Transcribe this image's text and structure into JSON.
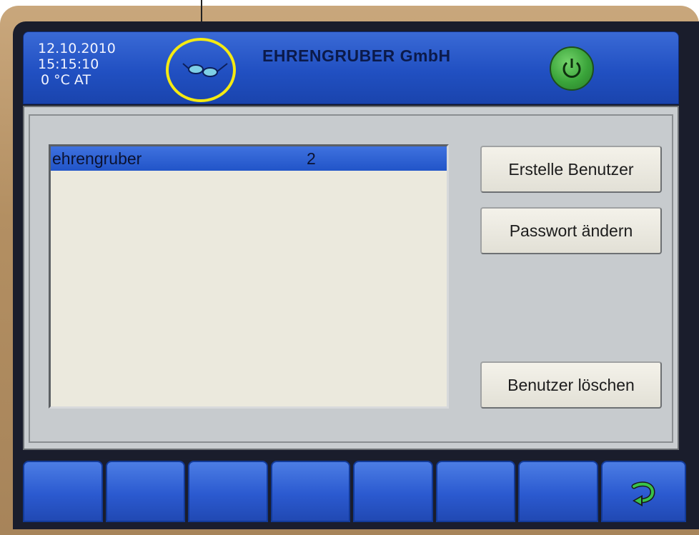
{
  "header": {
    "date": "12.10.2010",
    "time": "15:15:10",
    "temperature": "0 °C AT",
    "company": "EHRENGRUBER GmbH",
    "status_icon": "glasses-icon",
    "power_icon": "power-icon"
  },
  "users": [
    {
      "name": "ehrengruber",
      "level": "2",
      "selected": true
    }
  ],
  "buttons": {
    "create_user": "Erstelle Benutzer",
    "change_password": "Passwort ändern",
    "delete_user": "Benutzer löschen"
  },
  "footer": {
    "keys": [
      "",
      "",
      "",
      "",
      "",
      "",
      "",
      ""
    ],
    "last_key_icon": "back-arrow-icon"
  },
  "colors": {
    "header_blue": "#2150c2",
    "highlight_yellow": "#f4ea12",
    "power_green": "#3aa43a",
    "selection_blue": "#2154c8"
  }
}
